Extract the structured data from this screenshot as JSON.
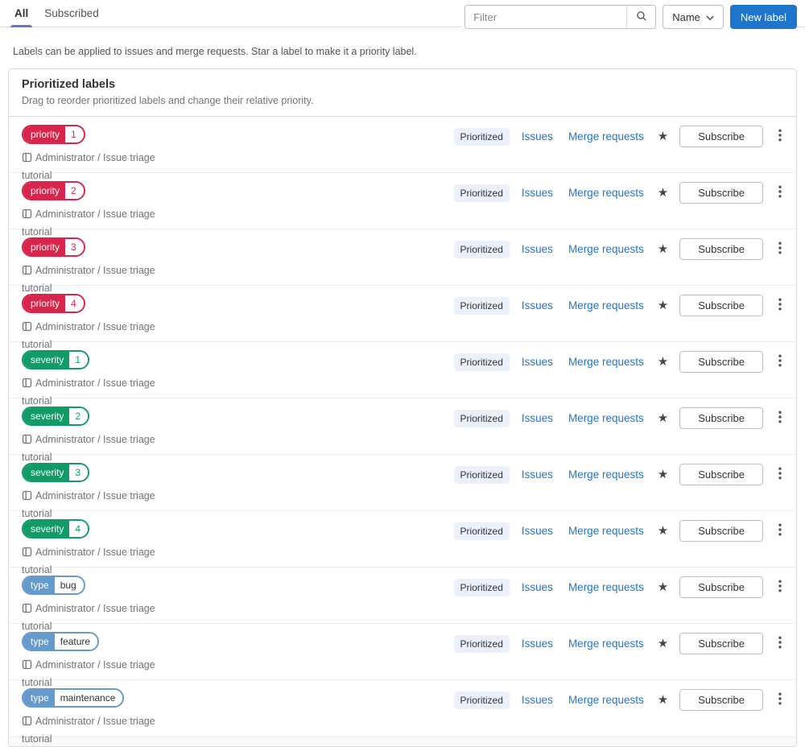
{
  "tabs": [
    "All",
    "Subscribed"
  ],
  "toolbar": {
    "filter_placeholder": "Filter",
    "sort_label": "Name",
    "new_label_button": "New label"
  },
  "description": "Labels can be applied to issues and merge requests. Star a label to make it a priority label.",
  "prioritized_card": {
    "title": "Prioritized labels",
    "subtitle": "Drag to reorder prioritized labels and change their relative priority."
  },
  "row_common": {
    "status_badge": "Prioritized",
    "issues_link": "Issues",
    "merge_requests_link": "Merge requests",
    "subscribe_button": "Subscribe",
    "project_line1": "Administrator / Issue triage",
    "project_line2": "tutorial",
    "star_icon": "★"
  },
  "colors": {
    "red": "#d9254c",
    "green": "#119c67",
    "blue": "#6699cc",
    "link": "#1f75cb",
    "accent_button": "#1f75cb",
    "tab_indicator": "#6673d4",
    "text_dark": "#333238"
  },
  "labels": [
    {
      "scope": "priority",
      "value": "1",
      "color_key": "red"
    },
    {
      "scope": "priority",
      "value": "2",
      "color_key": "red"
    },
    {
      "scope": "priority",
      "value": "3",
      "color_key": "red"
    },
    {
      "scope": "priority",
      "value": "4",
      "color_key": "red"
    },
    {
      "scope": "severity",
      "value": "1",
      "color_key": "green"
    },
    {
      "scope": "severity",
      "value": "2",
      "color_key": "green"
    },
    {
      "scope": "severity",
      "value": "3",
      "color_key": "green"
    },
    {
      "scope": "severity",
      "value": "4",
      "color_key": "green"
    },
    {
      "scope": "type",
      "value": "bug",
      "color_key": "blue",
      "value_text": "dark"
    },
    {
      "scope": "type",
      "value": "feature",
      "color_key": "blue",
      "value_text": "dark"
    },
    {
      "scope": "type",
      "value": "maintenance",
      "color_key": "blue",
      "value_text": "dark"
    }
  ]
}
